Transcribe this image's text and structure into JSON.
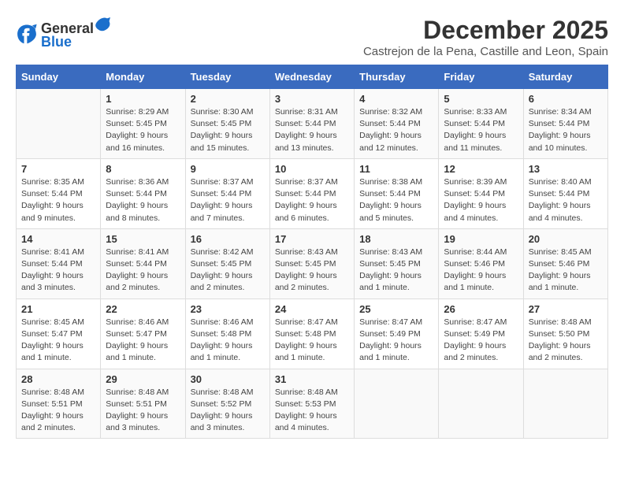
{
  "logo": {
    "general": "General",
    "blue": "Blue"
  },
  "title": "December 2025",
  "subtitle": "Castrejon de la Pena, Castille and Leon, Spain",
  "days_of_week": [
    "Sunday",
    "Monday",
    "Tuesday",
    "Wednesday",
    "Thursday",
    "Friday",
    "Saturday"
  ],
  "weeks": [
    [
      {
        "day": "",
        "sunrise": "",
        "sunset": "",
        "daylight": ""
      },
      {
        "day": "1",
        "sunrise": "Sunrise: 8:29 AM",
        "sunset": "Sunset: 5:45 PM",
        "daylight": "Daylight: 9 hours and 16 minutes."
      },
      {
        "day": "2",
        "sunrise": "Sunrise: 8:30 AM",
        "sunset": "Sunset: 5:45 PM",
        "daylight": "Daylight: 9 hours and 15 minutes."
      },
      {
        "day": "3",
        "sunrise": "Sunrise: 8:31 AM",
        "sunset": "Sunset: 5:44 PM",
        "daylight": "Daylight: 9 hours and 13 minutes."
      },
      {
        "day": "4",
        "sunrise": "Sunrise: 8:32 AM",
        "sunset": "Sunset: 5:44 PM",
        "daylight": "Daylight: 9 hours and 12 minutes."
      },
      {
        "day": "5",
        "sunrise": "Sunrise: 8:33 AM",
        "sunset": "Sunset: 5:44 PM",
        "daylight": "Daylight: 9 hours and 11 minutes."
      },
      {
        "day": "6",
        "sunrise": "Sunrise: 8:34 AM",
        "sunset": "Sunset: 5:44 PM",
        "daylight": "Daylight: 9 hours and 10 minutes."
      }
    ],
    [
      {
        "day": "7",
        "sunrise": "Sunrise: 8:35 AM",
        "sunset": "Sunset: 5:44 PM",
        "daylight": "Daylight: 9 hours and 9 minutes."
      },
      {
        "day": "8",
        "sunrise": "Sunrise: 8:36 AM",
        "sunset": "Sunset: 5:44 PM",
        "daylight": "Daylight: 9 hours and 8 minutes."
      },
      {
        "day": "9",
        "sunrise": "Sunrise: 8:37 AM",
        "sunset": "Sunset: 5:44 PM",
        "daylight": "Daylight: 9 hours and 7 minutes."
      },
      {
        "day": "10",
        "sunrise": "Sunrise: 8:37 AM",
        "sunset": "Sunset: 5:44 PM",
        "daylight": "Daylight: 9 hours and 6 minutes."
      },
      {
        "day": "11",
        "sunrise": "Sunrise: 8:38 AM",
        "sunset": "Sunset: 5:44 PM",
        "daylight": "Daylight: 9 hours and 5 minutes."
      },
      {
        "day": "12",
        "sunrise": "Sunrise: 8:39 AM",
        "sunset": "Sunset: 5:44 PM",
        "daylight": "Daylight: 9 hours and 4 minutes."
      },
      {
        "day": "13",
        "sunrise": "Sunrise: 8:40 AM",
        "sunset": "Sunset: 5:44 PM",
        "daylight": "Daylight: 9 hours and 4 minutes."
      }
    ],
    [
      {
        "day": "14",
        "sunrise": "Sunrise: 8:41 AM",
        "sunset": "Sunset: 5:44 PM",
        "daylight": "Daylight: 9 hours and 3 minutes."
      },
      {
        "day": "15",
        "sunrise": "Sunrise: 8:41 AM",
        "sunset": "Sunset: 5:44 PM",
        "daylight": "Daylight: 9 hours and 2 minutes."
      },
      {
        "day": "16",
        "sunrise": "Sunrise: 8:42 AM",
        "sunset": "Sunset: 5:45 PM",
        "daylight": "Daylight: 9 hours and 2 minutes."
      },
      {
        "day": "17",
        "sunrise": "Sunrise: 8:43 AM",
        "sunset": "Sunset: 5:45 PM",
        "daylight": "Daylight: 9 hours and 2 minutes."
      },
      {
        "day": "18",
        "sunrise": "Sunrise: 8:43 AM",
        "sunset": "Sunset: 5:45 PM",
        "daylight": "Daylight: 9 hours and 1 minute."
      },
      {
        "day": "19",
        "sunrise": "Sunrise: 8:44 AM",
        "sunset": "Sunset: 5:46 PM",
        "daylight": "Daylight: 9 hours and 1 minute."
      },
      {
        "day": "20",
        "sunrise": "Sunrise: 8:45 AM",
        "sunset": "Sunset: 5:46 PM",
        "daylight": "Daylight: 9 hours and 1 minute."
      }
    ],
    [
      {
        "day": "21",
        "sunrise": "Sunrise: 8:45 AM",
        "sunset": "Sunset: 5:47 PM",
        "daylight": "Daylight: 9 hours and 1 minute."
      },
      {
        "day": "22",
        "sunrise": "Sunrise: 8:46 AM",
        "sunset": "Sunset: 5:47 PM",
        "daylight": "Daylight: 9 hours and 1 minute."
      },
      {
        "day": "23",
        "sunrise": "Sunrise: 8:46 AM",
        "sunset": "Sunset: 5:48 PM",
        "daylight": "Daylight: 9 hours and 1 minute."
      },
      {
        "day": "24",
        "sunrise": "Sunrise: 8:47 AM",
        "sunset": "Sunset: 5:48 PM",
        "daylight": "Daylight: 9 hours and 1 minute."
      },
      {
        "day": "25",
        "sunrise": "Sunrise: 8:47 AM",
        "sunset": "Sunset: 5:49 PM",
        "daylight": "Daylight: 9 hours and 1 minute."
      },
      {
        "day": "26",
        "sunrise": "Sunrise: 8:47 AM",
        "sunset": "Sunset: 5:49 PM",
        "daylight": "Daylight: 9 hours and 2 minutes."
      },
      {
        "day": "27",
        "sunrise": "Sunrise: 8:48 AM",
        "sunset": "Sunset: 5:50 PM",
        "daylight": "Daylight: 9 hours and 2 minutes."
      }
    ],
    [
      {
        "day": "28",
        "sunrise": "Sunrise: 8:48 AM",
        "sunset": "Sunset: 5:51 PM",
        "daylight": "Daylight: 9 hours and 2 minutes."
      },
      {
        "day": "29",
        "sunrise": "Sunrise: 8:48 AM",
        "sunset": "Sunset: 5:51 PM",
        "daylight": "Daylight: 9 hours and 3 minutes."
      },
      {
        "day": "30",
        "sunrise": "Sunrise: 8:48 AM",
        "sunset": "Sunset: 5:52 PM",
        "daylight": "Daylight: 9 hours and 3 minutes."
      },
      {
        "day": "31",
        "sunrise": "Sunrise: 8:48 AM",
        "sunset": "Sunset: 5:53 PM",
        "daylight": "Daylight: 9 hours and 4 minutes."
      },
      {
        "day": "",
        "sunrise": "",
        "sunset": "",
        "daylight": ""
      },
      {
        "day": "",
        "sunrise": "",
        "sunset": "",
        "daylight": ""
      },
      {
        "day": "",
        "sunrise": "",
        "sunset": "",
        "daylight": ""
      }
    ]
  ]
}
